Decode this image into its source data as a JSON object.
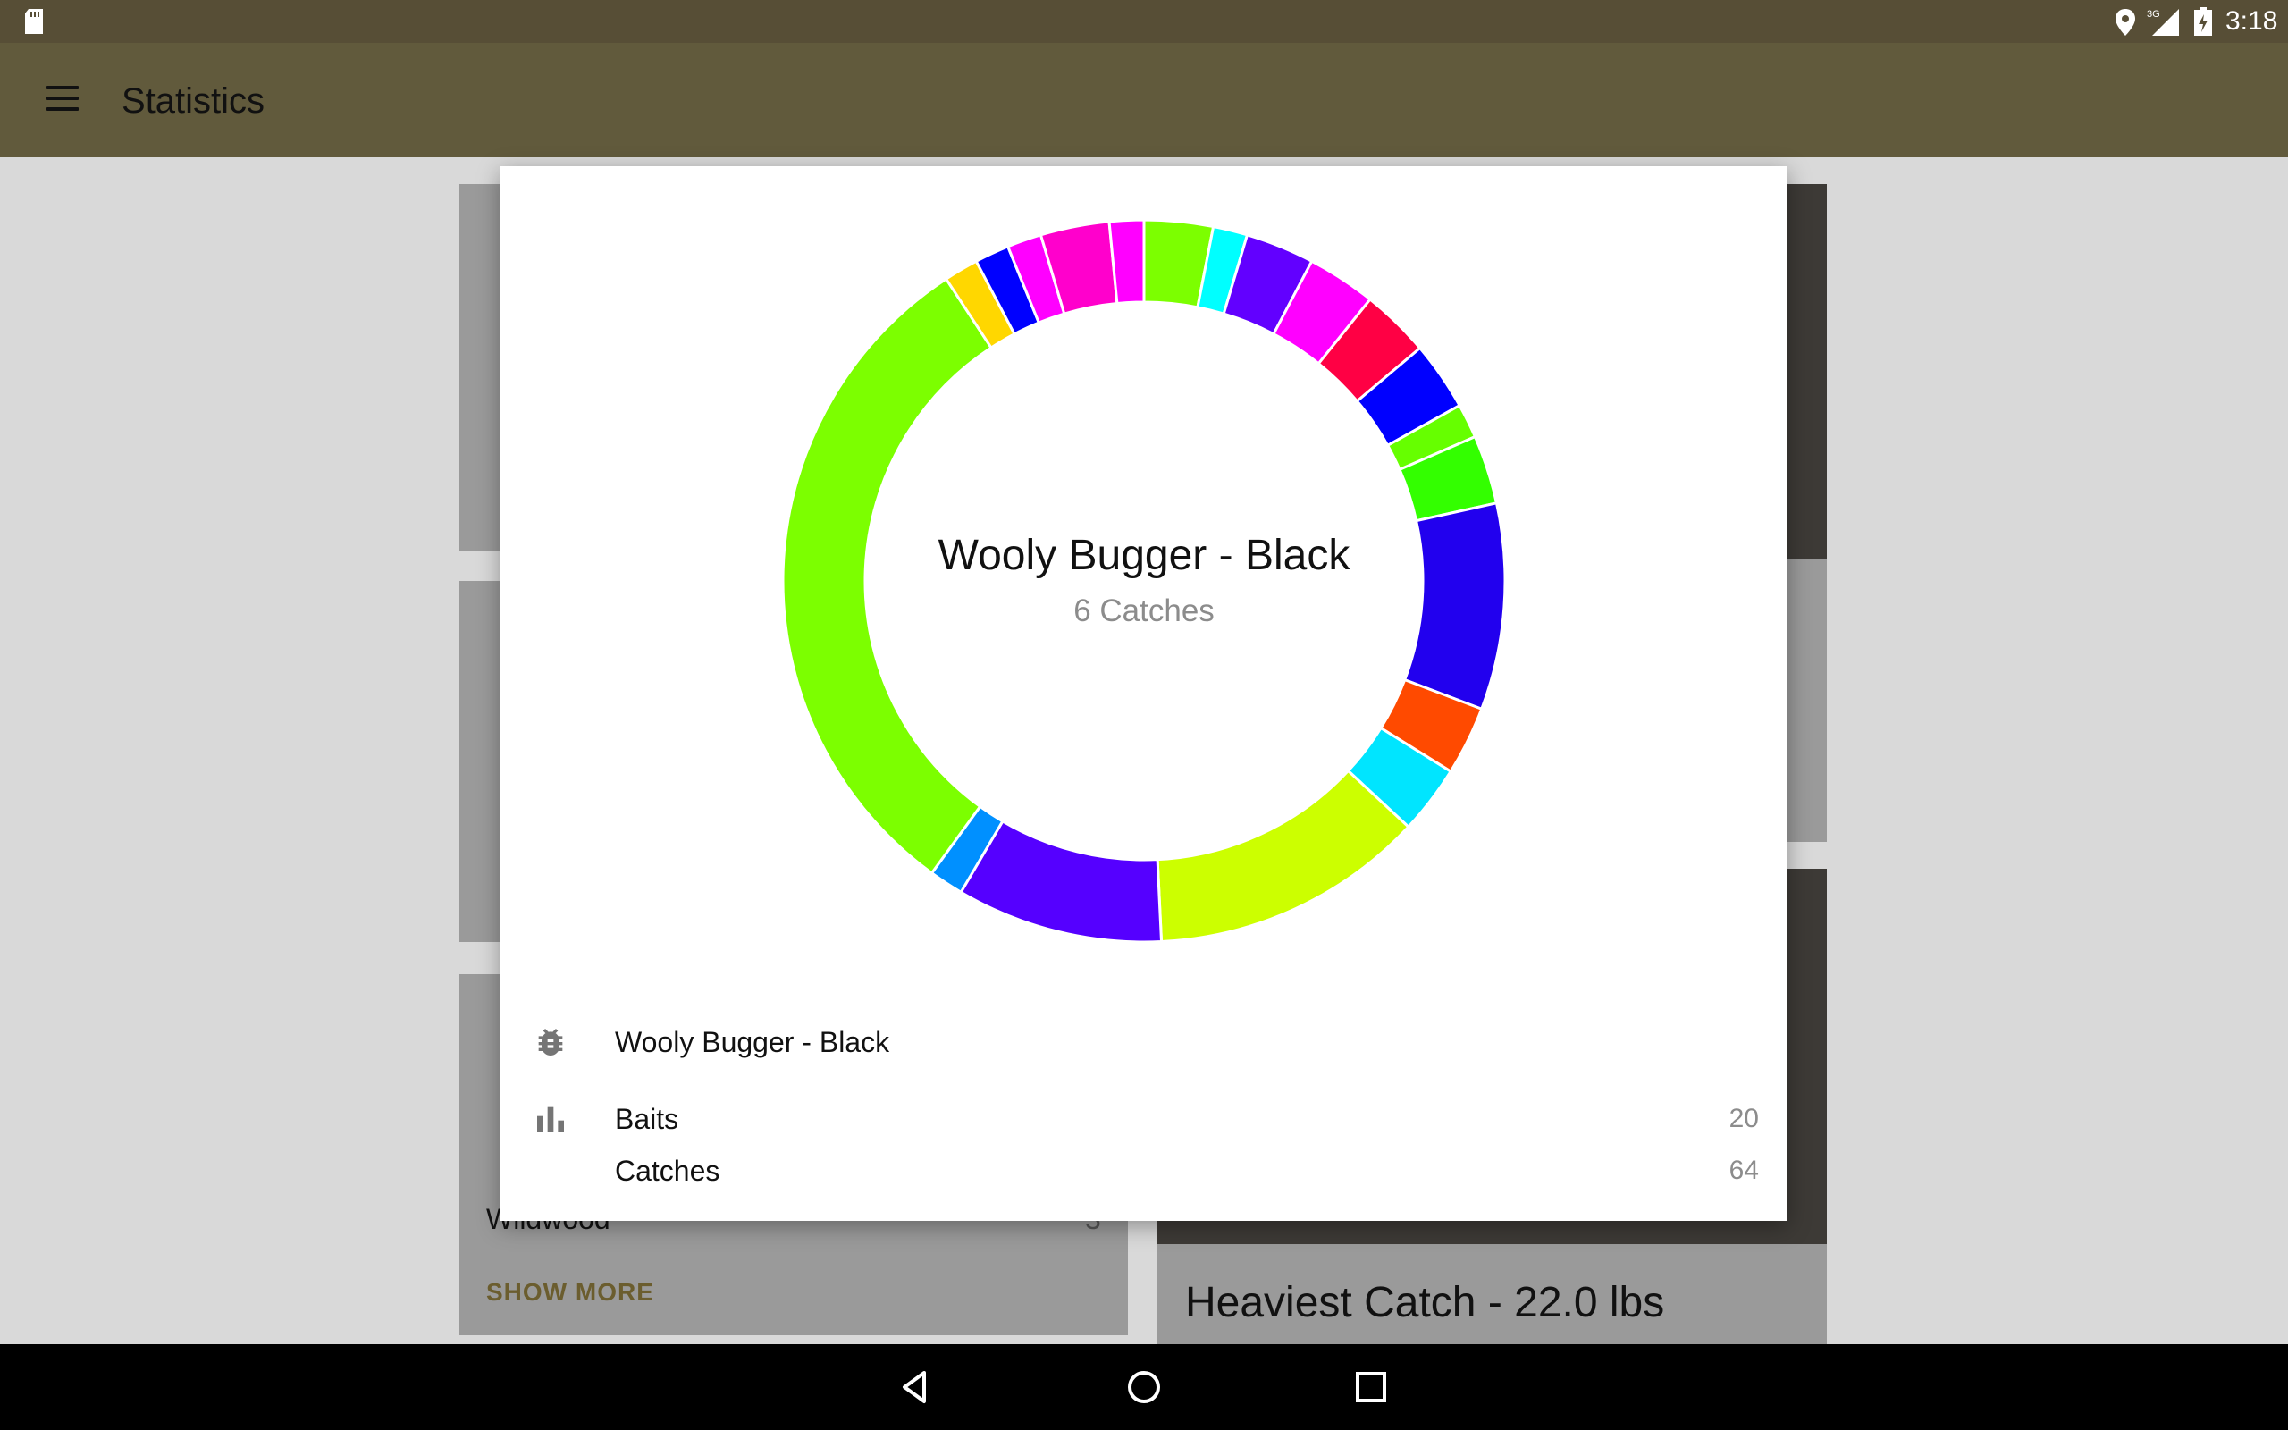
{
  "status_bar": {
    "time": "3:18",
    "network": "3G",
    "icons": [
      "sd-card-icon",
      "location-icon",
      "signal-icon",
      "battery-charging-icon"
    ]
  },
  "toolbar": {
    "title": "Statistics",
    "menu_icon": "menu-icon"
  },
  "background": {
    "show_more_label": "SHOW MORE",
    "list_item_label": "Wildwood",
    "list_item_value": "3",
    "heaviest_catch": "Heaviest Catch - 22.0 lbs"
  },
  "dialog": {
    "center_title": "Wooly Bugger - Black",
    "center_subtitle": "6 Catches",
    "selected_item": {
      "icon": "bug-icon",
      "label": "Wooly Bugger - Black"
    },
    "stats": [
      {
        "icon": "bar-chart-icon",
        "label": "Baits",
        "value": "20"
      },
      {
        "icon": "",
        "label": "Catches",
        "value": "64"
      }
    ]
  },
  "chart_data": {
    "type": "pie",
    "title": "",
    "slices": [
      {
        "value": 2,
        "color": "#7cff00"
      },
      {
        "value": 1,
        "color": "#00ffff"
      },
      {
        "value": 2,
        "color": "#6200ff"
      },
      {
        "value": 2,
        "color": "#ff00ff"
      },
      {
        "value": 2,
        "color": "#ff0044"
      },
      {
        "value": 2,
        "color": "#0000ff"
      },
      {
        "value": 1,
        "color": "#66ff00"
      },
      {
        "value": 2,
        "color": "#33ff00"
      },
      {
        "value": 6,
        "color": "#2200ee"
      },
      {
        "value": 2,
        "color": "#ff4a00"
      },
      {
        "value": 2,
        "color": "#00e5ff"
      },
      {
        "value": 8,
        "color": "#ccff00"
      },
      {
        "value": 6,
        "color": "#5500ff"
      },
      {
        "value": 1,
        "color": "#0090ff"
      },
      {
        "value": 20,
        "color": "#7cff00"
      },
      {
        "value": 1,
        "color": "#ffd700"
      },
      {
        "value": 1,
        "color": "#0000ff"
      },
      {
        "value": 1,
        "color": "#ff00ff"
      },
      {
        "value": 2,
        "color": "#ff00cc"
      },
      {
        "value": 1,
        "color": "#ff00ff"
      }
    ],
    "total": 64
  },
  "nav_bar": {
    "icons": [
      "back-icon",
      "home-icon",
      "recents-icon"
    ]
  }
}
